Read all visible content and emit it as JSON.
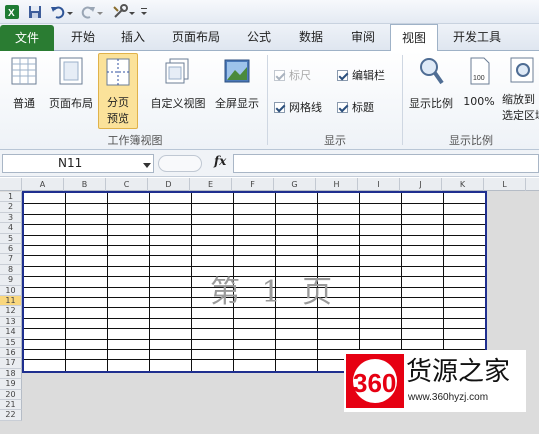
{
  "ribbon_tabs": [
    {
      "label": "文件"
    },
    {
      "label": "开始"
    },
    {
      "label": "插入"
    },
    {
      "label": "页面布局"
    },
    {
      "label": "公式"
    },
    {
      "label": "数据"
    },
    {
      "label": "审阅"
    },
    {
      "label": "视图"
    },
    {
      "label": "开发工具"
    }
  ],
  "groups": {
    "workbook_views": {
      "label": "工作簿视图",
      "buttons": {
        "normal": "普通",
        "page_layout": "页面布局",
        "page_break_preview_line1": "分页",
        "page_break_preview_line2": "预览",
        "custom_views": "自定义视图",
        "full_screen": "全屏显示"
      }
    },
    "show": {
      "label": "显示",
      "checkboxes": {
        "ruler": "标尺",
        "formula_bar": "编辑栏",
        "gridlines": "网格线",
        "headings": "标题"
      }
    },
    "zoom": {
      "label": "显示比例",
      "buttons": {
        "zoom": "显示比例",
        "hundred": "100%",
        "zoom_selection_line1": "缩放到",
        "zoom_selection_line2": "选定区域"
      }
    }
  },
  "formula_bar": {
    "name_box": "N11",
    "fx_label": "fx"
  },
  "columns": [
    "A",
    "B",
    "C",
    "D",
    "E",
    "F",
    "G",
    "H",
    "I",
    "J",
    "K",
    "L"
  ],
  "rows": [
    "1",
    "2",
    "3",
    "4",
    "5",
    "6",
    "7",
    "8",
    "9",
    "10",
    "11",
    "12",
    "13",
    "14",
    "15",
    "16",
    "17",
    "18",
    "19",
    "20",
    "21",
    "22"
  ],
  "selected_row": "11",
  "watermark": "第 1 页",
  "logo": {
    "number": "360",
    "name": "货源之家",
    "url": "www.360hyzj.com"
  }
}
